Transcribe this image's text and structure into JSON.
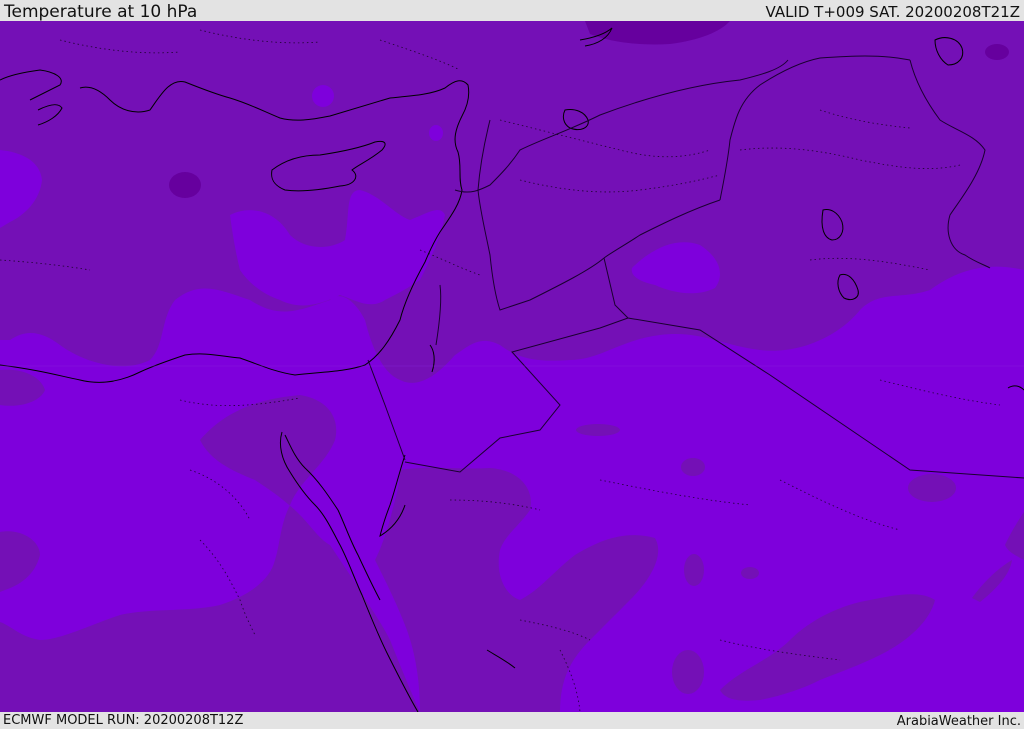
{
  "header": {
    "title": "Temperature at 10 hPa",
    "valid_time": "VALID T+009 SAT. 20200208T21Z"
  },
  "footer": {
    "model_run": "ECMWF MODEL RUN: 20200208T12Z",
    "credit": "ArabiaWeather Inc."
  },
  "map": {
    "variable": "temperature",
    "level": "10 hPa",
    "colors": {
      "cold_band": "#7e00dc",
      "mid_band": "#7410b6",
      "coldest_band": "#66009e",
      "coastline": "#000000",
      "border": "#1a0030"
    }
  }
}
